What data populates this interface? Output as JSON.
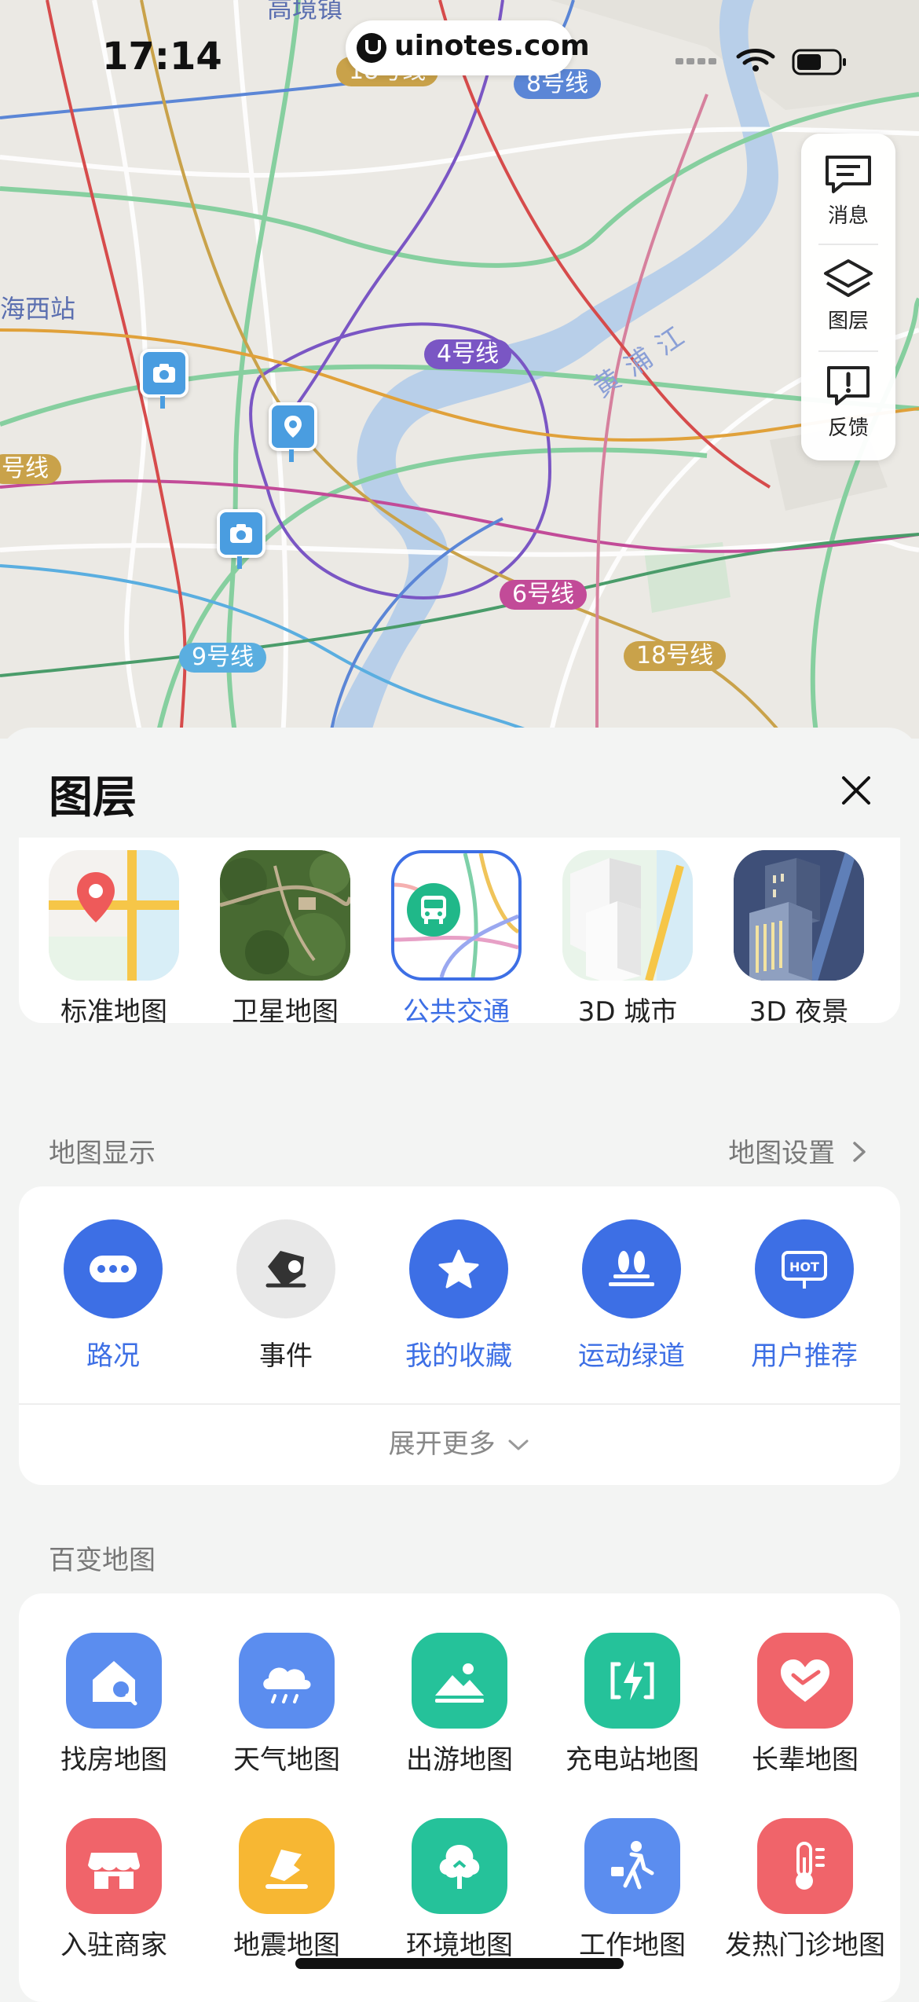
{
  "status_bar": {
    "time": "17:14",
    "url": "uinotes.com"
  },
  "map": {
    "place_labels": [
      "高境镇",
      "海西站"
    ],
    "river_label": "黄浦江",
    "metro_lines": [
      {
        "label": "8号线",
        "color": "#5b86d6"
      },
      {
        "label": "4号线",
        "color": "#7a56c4"
      },
      {
        "label": "6号线",
        "color": "#c24b98"
      },
      {
        "label": "9号线",
        "color": "#5aaee0"
      },
      {
        "label": "18号线",
        "color": "#c9a24a"
      },
      {
        "label": "号线",
        "color": "#c9a24a"
      },
      {
        "label": "18号线",
        "color": "#c9a24a"
      }
    ],
    "tools": [
      {
        "label": "消息",
        "icon": "message-icon"
      },
      {
        "label": "图层",
        "icon": "layers-icon"
      },
      {
        "label": "反馈",
        "icon": "feedback-icon"
      }
    ]
  },
  "sheet": {
    "title": "图层",
    "map_types": [
      {
        "label": "标准地图",
        "icon": "standard-map-thumb",
        "active": false
      },
      {
        "label": "卫星地图",
        "icon": "satellite-map-thumb",
        "active": false
      },
      {
        "label": "公共交通",
        "icon": "public-transit-thumb",
        "active": true
      },
      {
        "label": "3D 城市",
        "icon": "3d-city-thumb",
        "active": false
      },
      {
        "label": "3D 夜景",
        "icon": "3d-night-thumb",
        "active": false
      }
    ],
    "display_section": {
      "title": "地图显示",
      "settings_link": "地图设置",
      "items": [
        {
          "label": "路况",
          "icon": "traffic-icon",
          "active": true
        },
        {
          "label": "事件",
          "icon": "event-icon",
          "active": false
        },
        {
          "label": "我的收藏",
          "icon": "star-icon",
          "active": true
        },
        {
          "label": "运动绿道",
          "icon": "greenway-icon",
          "active": true
        },
        {
          "label": "用户推荐",
          "icon": "hot-icon",
          "active": true
        }
      ],
      "expand_label": "展开更多"
    },
    "variety_section": {
      "title": "百变地图",
      "items": [
        {
          "label": "找房地图",
          "icon": "house-search-icon",
          "color": "#5b8def"
        },
        {
          "label": "天气地图",
          "icon": "weather-icon",
          "color": "#5b8def"
        },
        {
          "label": "出游地图",
          "icon": "travel-icon",
          "color": "#25c29a"
        },
        {
          "label": "充电站地图",
          "icon": "charging-icon",
          "color": "#25c29a"
        },
        {
          "label": "长辈地图",
          "icon": "elder-heart-icon",
          "color": "#f0646a"
        },
        {
          "label": "入驻商家",
          "icon": "store-icon",
          "color": "#f0646a"
        },
        {
          "label": "地震地图",
          "icon": "earthquake-icon",
          "color": "#f7b733"
        },
        {
          "label": "环境地图",
          "icon": "environment-icon",
          "color": "#25c29a"
        },
        {
          "label": "工作地图",
          "icon": "work-icon",
          "color": "#5b8def"
        },
        {
          "label": "发热门诊地图",
          "icon": "fever-clinic-icon",
          "color": "#f0646a"
        }
      ]
    }
  },
  "colors": {
    "accent": "#3d6fe5",
    "inactive_circle": "#e8e8e8"
  }
}
